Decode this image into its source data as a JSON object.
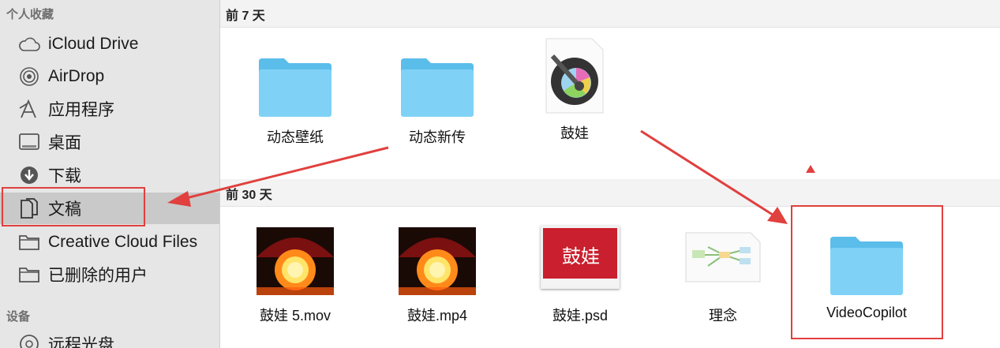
{
  "sidebar": {
    "favorites_title": "个人收藏",
    "devices_title": "设备",
    "items": [
      {
        "label": "iCloud Drive",
        "icon": "cloud-icon"
      },
      {
        "label": "AirDrop",
        "icon": "airdrop-icon"
      },
      {
        "label": "应用程序",
        "icon": "applications-icon"
      },
      {
        "label": "桌面",
        "icon": "desktop-icon"
      },
      {
        "label": "下载",
        "icon": "download-icon"
      },
      {
        "label": "文稿",
        "icon": "documents-icon",
        "selected": true
      },
      {
        "label": "Creative Cloud Files",
        "icon": "folder-icon"
      },
      {
        "label": "已删除的用户",
        "icon": "folder-icon"
      }
    ],
    "device_items": [
      {
        "label": "远程光盘",
        "icon": "disc-icon"
      }
    ]
  },
  "main": {
    "groups": [
      {
        "title": "前 7 天",
        "files": [
          {
            "name": "动态壁纸",
            "kind": "folder"
          },
          {
            "name": "动态新传",
            "kind": "folder"
          },
          {
            "name": "鼓娃",
            "kind": "motion-app"
          }
        ]
      },
      {
        "title": "前 30 天",
        "files": [
          {
            "name": "鼓娃 5.mov",
            "kind": "video"
          },
          {
            "name": "鼓娃.mp4",
            "kind": "video"
          },
          {
            "name": "鼓娃.psd",
            "kind": "psd",
            "thumb_text": "鼓娃"
          },
          {
            "name": "理念",
            "kind": "document"
          },
          {
            "name": "VideoCopilot",
            "kind": "folder"
          }
        ]
      }
    ]
  },
  "colors": {
    "sidebar_bg": "#e6e6e6",
    "selected_bg": "#c9c9c9",
    "folder_blue": "#6ccaf2",
    "annotation_red": "#e0403e"
  }
}
